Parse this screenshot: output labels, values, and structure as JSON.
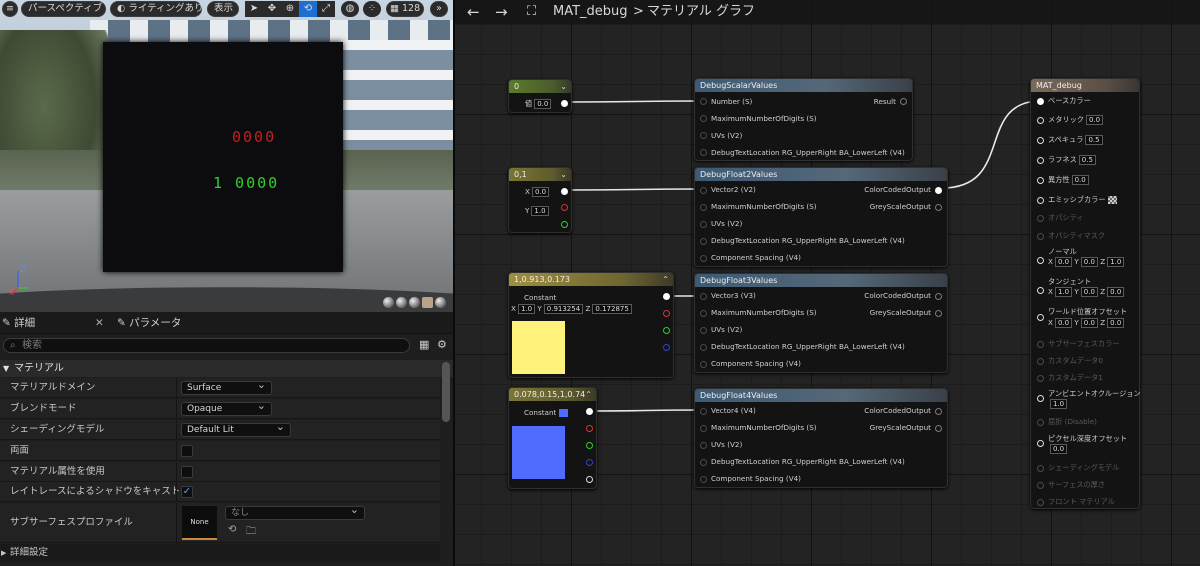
{
  "viewport": {
    "toolbar": {
      "perspective": "パースペクティブ",
      "lighting": "ライティングあり",
      "show": "表示",
      "grid_value": "128",
      "more": "»"
    },
    "display_red": "0000",
    "display_green": "1 0000"
  },
  "details": {
    "tab_details": "詳細",
    "tab_params": "パラメータ",
    "search_placeholder": "検索",
    "section_material": "マテリアル",
    "props": [
      {
        "label": "マテリアルドメイン",
        "value": "Surface"
      },
      {
        "label": "ブレンドモード",
        "value": "Opaque"
      },
      {
        "label": "シェーディングモデル",
        "value": "Default Lit"
      },
      {
        "label": "両面",
        "checked": false
      },
      {
        "label": "マテリアル属性を使用",
        "checked": false
      },
      {
        "label": "レイトレースによるシャドウをキャスト",
        "checked": true
      },
      {
        "label": "サブサーフェスプロファイル",
        "value": "なし",
        "thumb": "None"
      }
    ],
    "advanced": "詳細設定",
    "check_glyph": "✓"
  },
  "graph": {
    "breadcrumb_asset": "MAT_debug",
    "breadcrumb_sep": ">",
    "breadcrumb_graph": "マテリアル グラフ",
    "nodes": {
      "scalar_const": {
        "title": "0",
        "label": "値",
        "value": "0.0"
      },
      "vec2_const": {
        "title": "0,1",
        "x_label": "X",
        "x": "0.0",
        "y_label": "Y",
        "y": "1.0"
      },
      "vec3_const": {
        "title": "1,0.913,0.173",
        "label": "Constant",
        "x": "1.0",
        "y": "0.913254",
        "z": "0.172875",
        "color": "#fff27a"
      },
      "vec4_const": {
        "title": "0.078,0.15,1,0.74",
        "label": "Constant",
        "color": "#4f6cff"
      },
      "debug_scalar": {
        "title": "DebugScalarValues",
        "inputs": [
          "Number (S)",
          "MaximumNumberOfDigits (S)",
          "UVs (V2)",
          "DebugTextLocation RG_UpperRight BA_LowerLeft (V4)"
        ],
        "output": "Result"
      },
      "debug_float2": {
        "title": "DebugFloat2Values",
        "inputs": [
          "Vector2 (V2)",
          "MaximumNumberOfDigits (S)",
          "UVs (V2)",
          "DebugTextLocation RG_UpperRight BA_LowerLeft (V4)",
          "Component Spacing (V4)"
        ],
        "outputs": [
          "ColorCodedOutput",
          "GreyScaleOutput"
        ]
      },
      "debug_float3": {
        "title": "DebugFloat3Values",
        "inputs": [
          "Vector3 (V3)",
          "MaximumNumberOfDigits (S)",
          "UVs (V2)",
          "DebugTextLocation RG_UpperRight BA_LowerLeft (V4)",
          "Component Spacing (V4)"
        ],
        "outputs": [
          "ColorCodedOutput",
          "GreyScaleOutput"
        ]
      },
      "debug_float4": {
        "title": "DebugFloat4Values",
        "inputs": [
          "Vector4 (V4)",
          "MaximumNumberOfDigits (S)",
          "UVs (V2)",
          "DebugTextLocation RG_UpperRight BA_LowerLeft (V4)",
          "Component Spacing (V4)"
        ],
        "outputs": [
          "ColorCodedOutput",
          "GreyScaleOutput"
        ]
      },
      "material": {
        "title": "MAT_debug",
        "pins": {
          "base_color": "ベースカラー",
          "metallic": "メタリック",
          "metallic_v": "0.0",
          "specular": "スペキュラ",
          "specular_v": "0.5",
          "roughness": "ラフネス",
          "roughness_v": "0.5",
          "anisotropy": "異方性",
          "anisotropy_v": "0.0",
          "emissive": "エミッシブカラー",
          "opacity": "オパシティ",
          "opacity_mask": "オパシティマスク",
          "normal": "ノーマル",
          "normal_x": "0.0",
          "normal_y": "0.0",
          "normal_z": "1.0",
          "tangent": "タンジェント",
          "tangent_x": "1.0",
          "tangent_y": "0.0",
          "tangent_z": "0.0",
          "wpo": "ワールド位置オフセット",
          "wpo_x": "0.0",
          "wpo_y": "0.0",
          "wpo_z": "0.0",
          "subsurface": "サブサーフェスカラー",
          "custom0": "カスタムデータ0",
          "custom1": "カスタムデータ1",
          "ao": "アンビエントオクルージョン",
          "ao_v": "1.0",
          "refraction": "屈折 (Disable)",
          "pdo": "ピクセル深度オフセット",
          "pdo_v": "0.0",
          "shading_model": "シェーディングモデル",
          "surface_thickness": "サーフェスの厚さ",
          "front_material": "フロント マテリアル"
        }
      }
    }
  },
  "labels": {
    "x": "X",
    "y": "Y",
    "z": "Z"
  }
}
